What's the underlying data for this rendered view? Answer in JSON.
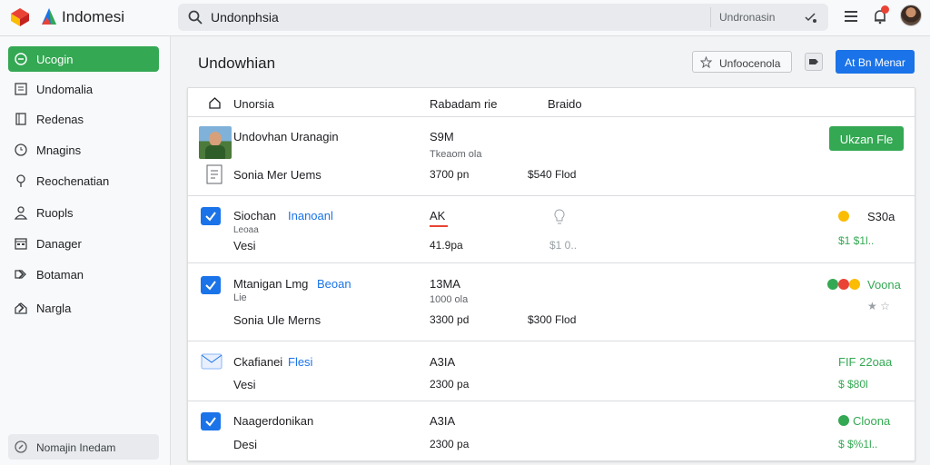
{
  "app": {
    "title": "Indomesi"
  },
  "search": {
    "query": "Undonphsia",
    "hint": "Undronasin"
  },
  "sidebar": {
    "items": [
      {
        "label": "Ucogin",
        "icon": "circle-check-icon",
        "active": true
      },
      {
        "label": "Undomalia",
        "icon": "list-icon"
      },
      {
        "label": "Redenas",
        "icon": "bookmark-icon"
      },
      {
        "label": "Mnagins",
        "icon": "clock-icon"
      },
      {
        "label": "Reochenatian",
        "icon": "pin-icon"
      },
      {
        "label": "Ruopls",
        "icon": "person-icon"
      },
      {
        "label": "Danager",
        "icon": "calendar-icon"
      },
      {
        "label": "Botaman",
        "icon": "tag-icon"
      },
      {
        "label": "Nargla",
        "icon": "home-icon"
      }
    ],
    "footer": "Nomajin Inedam"
  },
  "main": {
    "title": "Undowhian",
    "outline_button": "Unfoocenola",
    "primary_button": "At Bn Menar"
  },
  "table": {
    "headers": [
      "Unorsia",
      "Rabadam rie",
      "Braido"
    ],
    "rows": [
      {
        "title": "Undovhan Uranagin",
        "sub_label": "Sonia Mer Uems",
        "amount": "S9M",
        "amount_note": "Tkeaom ola",
        "time": "3700 pn",
        "price": "$540 Flod",
        "action": "Ukzan Fle"
      },
      {
        "title": "Siochan",
        "title_link": "Inanoanl",
        "note": "Leoaa",
        "sub_label": "Vesi",
        "amount": "AK",
        "time": "41.9pa",
        "price": "$1 0..",
        "status": "S30a",
        "status_sub": "$1 $1l.."
      },
      {
        "title": "Mtanigan Lmg",
        "title_link": "Beoan",
        "note": "Lie",
        "sub_label": "Sonia Ule Merns",
        "amount": "13MA",
        "amount_note": "1000 ola",
        "time": "3300 pd",
        "price": "$300 Flod",
        "status": "Voona",
        "status_sub": "★ ☆"
      },
      {
        "title": "Ckafianei",
        "title_link": "Flesi",
        "sub_label": "Vesi",
        "amount": "A3IA",
        "time": "2300 pa",
        "status": "FIF 22oaa",
        "status_sub": "$ $80l"
      },
      {
        "title": "Naagerdonikan",
        "sub_label": "Desi",
        "amount": "A3IA",
        "time": "2300 pa",
        "status": "Cloona",
        "status_sub": "$ $%1l.."
      }
    ]
  },
  "colors": {
    "accent": "#1a73e8",
    "success": "#34a853",
    "danger": "#ea4335",
    "warning": "#fbbc04"
  }
}
